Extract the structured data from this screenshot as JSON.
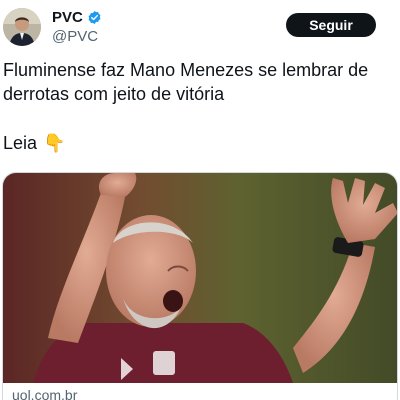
{
  "author": {
    "display_name": "PVC",
    "handle": "@PVC",
    "verified": true,
    "avatar_icon": "profile-photo"
  },
  "follow_button": {
    "label": "Seguir"
  },
  "tweet": {
    "line1": "Fluminense faz Mano Menezes se lembrar de",
    "line2": "derrotas com jeito de vitória",
    "read_label": "Leia",
    "read_emoji": "👇"
  },
  "link_card": {
    "domain": "uol.com.br",
    "image_icon": "coach-celebrating-photo"
  },
  "colors": {
    "text_primary": "#0f1419",
    "text_secondary": "#536471",
    "verified_blue": "#1d9bf0",
    "button_bg": "#0f1419",
    "card_border": "#cfd9de"
  }
}
